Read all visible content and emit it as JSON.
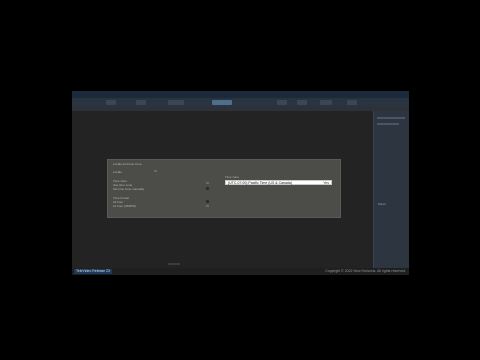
{
  "dialog": {
    "title": "Locale and time zone",
    "locale_label": "Locale",
    "section_1": "Time zone",
    "option_auto_tz": "Use time zone",
    "option_manual_tz": "Set time zone manually",
    "section_2": "Time format",
    "option_24h": "24 hour",
    "option_12h": "12 hour (AM/PM)",
    "tz_caption": "Time zone",
    "tz_value": "(UTC-07:00) Pacific Time (US & Canada)",
    "tz_dropdown": "Yes"
  },
  "status": {
    "left": "TeleVideo Release 23",
    "right": "Copyright © 2022 New Horizons. All rights reserved."
  },
  "right_pane": {
    "label": "Panel"
  },
  "colors": {
    "accent": "#1c3b5a",
    "dialog_bg": "#4c4c49",
    "screen_bg": "#232323"
  },
  "icons": {
    "dropdown": "chevron-down-icon"
  }
}
